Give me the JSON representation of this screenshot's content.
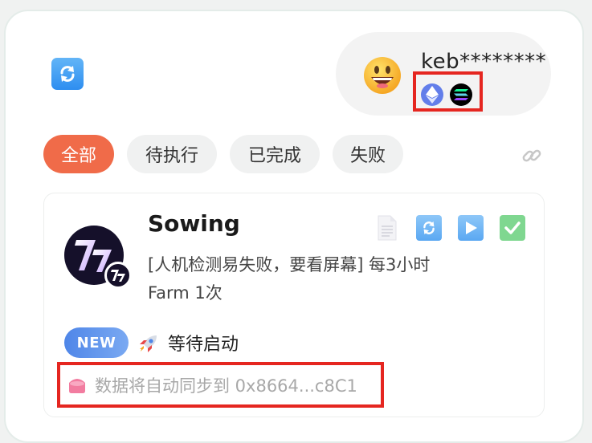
{
  "header": {
    "refresh_icon": "refresh-icon",
    "avatar_icon": "grinning-face-emoji",
    "username": "keb********",
    "chains": [
      {
        "name": "ethereum",
        "icon": "ethereum-icon",
        "color": "#627eea"
      },
      {
        "name": "solana",
        "icon": "solana-icon",
        "color": "#000000"
      }
    ]
  },
  "tabs": [
    {
      "label": "全部",
      "active": true
    },
    {
      "label": "待执行",
      "active": false
    },
    {
      "label": "已完成",
      "active": false
    },
    {
      "label": "失败",
      "active": false
    }
  ],
  "link_icon": "link-icon",
  "task": {
    "title": "Sowing",
    "description": "[人机检测易失败，要看屏幕] 每3小时Farm 1次",
    "badge": "NEW",
    "status_icon": "rocket-icon",
    "status": "等待启动",
    "sync_icon": "wallet-icon",
    "sync_text": "数据将自动同步到 0x8664...c8C1",
    "actions": [
      "document-icon",
      "refresh-icon",
      "play-icon",
      "check-icon"
    ]
  },
  "colors": {
    "accent": "#f06b49",
    "new_badge": "#4f86e8",
    "highlight_box": "#e52620"
  }
}
